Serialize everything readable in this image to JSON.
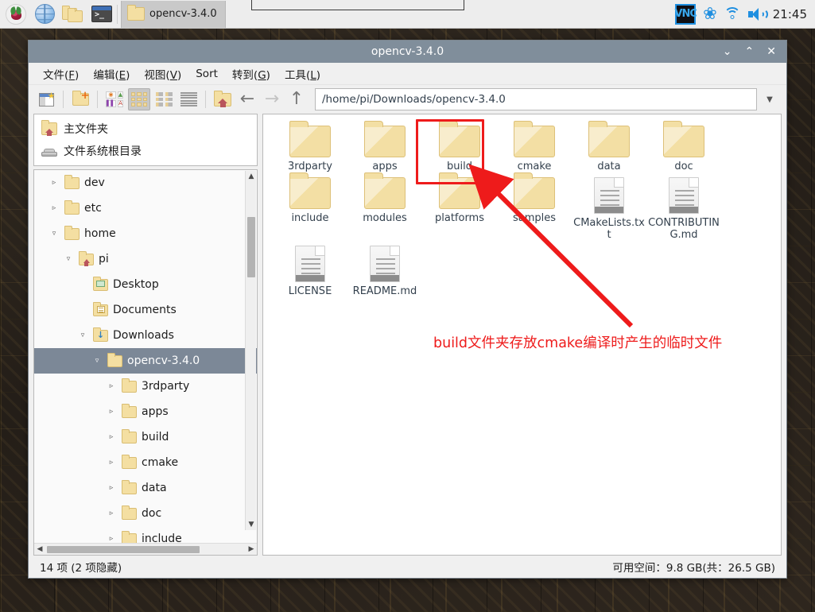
{
  "taskbar": {
    "launchers": [
      {
        "name": "raspberry-menu",
        "icon": "raspberry-icon"
      },
      {
        "name": "web-browser",
        "icon": "globe-icon"
      },
      {
        "name": "file-manager",
        "icon": "folders-icon"
      },
      {
        "name": "terminal",
        "icon": "terminal-icon"
      }
    ],
    "window_button": {
      "label": "opencv-3.4.0",
      "icon": "folder-icon"
    },
    "tray": {
      "vnc_label": "VNC",
      "bluetooth_icon": "bluetooth-icon",
      "wifi_icon": "wifi-icon",
      "volume_icon": "speaker-icon",
      "clock": "21:45"
    }
  },
  "window": {
    "title": "opencv-3.4.0",
    "controls": {
      "minimize": "⌄",
      "maximize": "⌃",
      "close": "✕"
    },
    "menus": [
      {
        "label": "文件",
        "accel": "F"
      },
      {
        "label": "编辑",
        "accel": "E"
      },
      {
        "label": "视图",
        "accel": "V"
      },
      {
        "label": "Sort",
        "accel": "o"
      },
      {
        "label": "转到",
        "accel": "G"
      },
      {
        "label": "工具",
        "accel": "L"
      }
    ],
    "toolbar": {
      "new_tab": "new-tab-button",
      "new_folder": "new-folder-button",
      "file_types": "file-type-filter-button",
      "view_icon": "icon-view-button",
      "view_compact": "compact-view-button",
      "view_detail": "detail-view-button",
      "home": "home-button",
      "back": "←",
      "forward": "→",
      "up": "↑",
      "dropdown": "▼"
    },
    "path": "/home/pi/Downloads/opencv-3.4.0"
  },
  "sidebar": {
    "places": [
      {
        "label": "主文件夹",
        "icon": "home-folder-icon"
      },
      {
        "label": "文件系统根目录",
        "icon": "drive-icon"
      }
    ],
    "tree": [
      {
        "label": "dev",
        "indent": 1,
        "twisty": "▹",
        "icon": "folder-icon",
        "selected": false
      },
      {
        "label": "etc",
        "indent": 1,
        "twisty": "▹",
        "icon": "folder-icon",
        "selected": false
      },
      {
        "label": "home",
        "indent": 1,
        "twisty": "▿",
        "icon": "folder-icon",
        "selected": false
      },
      {
        "label": "pi",
        "indent": 2,
        "twisty": "▿",
        "icon": "home-folder-icon",
        "selected": false
      },
      {
        "label": "Desktop",
        "indent": 3,
        "twisty": "",
        "icon": "desktop-folder-icon",
        "selected": false
      },
      {
        "label": "Documents",
        "indent": 3,
        "twisty": "",
        "icon": "documents-folder-icon",
        "selected": false
      },
      {
        "label": "Downloads",
        "indent": 3,
        "twisty": "▿",
        "icon": "downloads-folder-icon",
        "selected": false
      },
      {
        "label": "opencv-3.4.0",
        "indent": 4,
        "twisty": "▿",
        "icon": "folder-icon",
        "selected": true
      },
      {
        "label": "3rdparty",
        "indent": 5,
        "twisty": "▹",
        "icon": "folder-icon",
        "selected": false
      },
      {
        "label": "apps",
        "indent": 5,
        "twisty": "▹",
        "icon": "folder-icon",
        "selected": false
      },
      {
        "label": "build",
        "indent": 5,
        "twisty": "▹",
        "icon": "folder-icon",
        "selected": false
      },
      {
        "label": "cmake",
        "indent": 5,
        "twisty": "▹",
        "icon": "folder-icon",
        "selected": false
      },
      {
        "label": "data",
        "indent": 5,
        "twisty": "▹",
        "icon": "folder-icon",
        "selected": false
      },
      {
        "label": "doc",
        "indent": 5,
        "twisty": "▹",
        "icon": "folder-icon",
        "selected": false
      },
      {
        "label": "include",
        "indent": 5,
        "twisty": "▹",
        "icon": "folder-icon",
        "selected": false
      }
    ],
    "scroll": {
      "up": "▲",
      "down": "▼",
      "left": "◀",
      "right": "▶"
    }
  },
  "files": [
    {
      "name": "3rdparty",
      "type": "folder"
    },
    {
      "name": "apps",
      "type": "folder"
    },
    {
      "name": "build",
      "type": "folder",
      "highlighted": true
    },
    {
      "name": "cmake",
      "type": "folder"
    },
    {
      "name": "data",
      "type": "folder"
    },
    {
      "name": "doc",
      "type": "folder"
    },
    {
      "name": "include",
      "type": "folder"
    },
    {
      "name": "modules",
      "type": "folder"
    },
    {
      "name": "platforms",
      "type": "folder"
    },
    {
      "name": "samples",
      "type": "folder"
    },
    {
      "name": "CMakeLists.txt",
      "type": "document"
    },
    {
      "name": "CONTRIBUTING.md",
      "type": "document"
    },
    {
      "name": "LICENSE",
      "type": "document"
    },
    {
      "name": "README.md",
      "type": "document"
    }
  ],
  "annotation": {
    "text": "build文件夹存放cmake编译时产生的临时文件",
    "color": "#ee1b1b"
  },
  "statusbar": {
    "left": "14 项 (2 项隐藏)",
    "right": "可用空间：9.8 GB(共：26.5 GB)"
  }
}
